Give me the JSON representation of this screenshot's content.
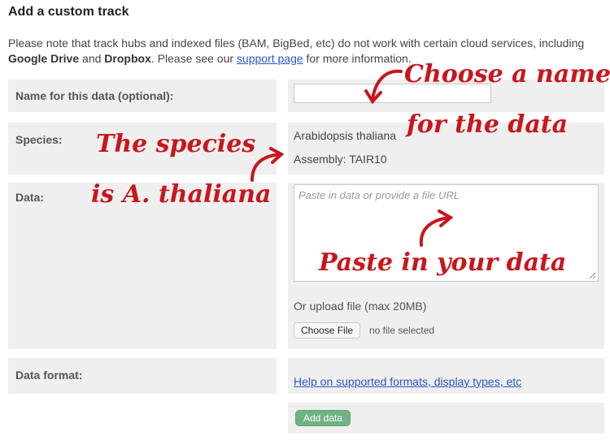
{
  "page": {
    "title": "Add a custom track",
    "note": {
      "part1": "Please note that track hubs and indexed files (BAM, BigBed, etc) do not work with certain cloud services, including ",
      "google_drive": "Google Drive",
      "and": " and ",
      "dropbox": "Dropbox",
      "part2": ". Please see our ",
      "support_link": "support page",
      "part3": " for more information."
    }
  },
  "form": {
    "name_label": "Name for this data (optional):",
    "name_value": "",
    "species_label": "Species:",
    "species_name": "Arabidopsis thaliana",
    "assembly": "Assembly: TAIR10",
    "data_label": "Data:",
    "data_placeholder": "Paste in data or provide a file URL",
    "upload_label": "Or upload file (max 20MB)",
    "choose_file_button": "Choose File",
    "no_file_text": "no file selected",
    "format_label": "Data format:",
    "help_link": "Help on supported formats, display types, etc",
    "add_button": "Add data"
  },
  "annotations": {
    "name_line1": "Choose a name",
    "name_line2": "for the data",
    "species_line1": "The species",
    "species_line2": "is A. thaliana",
    "paste": "Paste in your data"
  },
  "colors": {
    "annotation_red": "#c8161d",
    "link_blue": "#2a56c6",
    "button_green": "#6fb284",
    "panel_gray": "#efefef"
  }
}
